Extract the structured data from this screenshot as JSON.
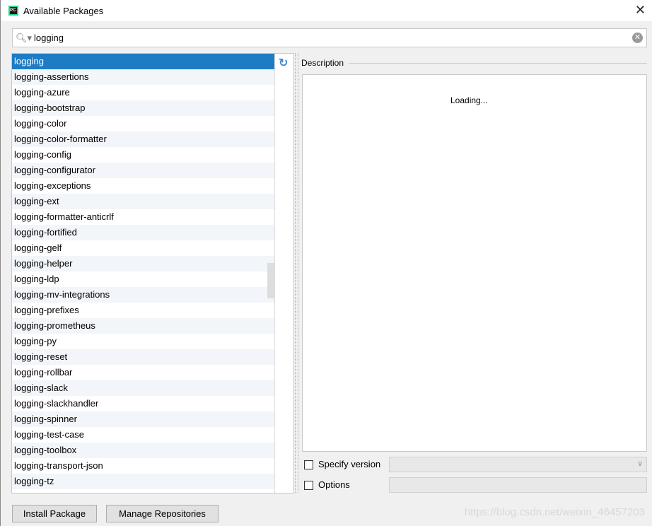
{
  "window": {
    "title": "Available Packages",
    "app_icon": "pycharm-icon",
    "close_icon": "close-icon"
  },
  "search": {
    "value": "logging",
    "icon": "search-icon",
    "clear_icon": "clear-icon"
  },
  "packages": [
    "logging",
    "logging-assertions",
    "logging-azure",
    "logging-bootstrap",
    "logging-color",
    "logging-color-formatter",
    "logging-config",
    "logging-configurator",
    "logging-exceptions",
    "logging-ext",
    "logging-formatter-anticrlf",
    "logging-fortified",
    "logging-gelf",
    "logging-helper",
    "logging-ldp",
    "logging-mv-integrations",
    "logging-prefixes",
    "logging-prometheus",
    "logging-py",
    "logging-reset",
    "logging-rollbar",
    "logging-slack",
    "logging-slackhandler",
    "logging-spinner",
    "logging-test-case",
    "logging-toolbox",
    "logging-transport-json",
    "logging-tz"
  ],
  "selected": "logging",
  "description": {
    "label": "Description",
    "content": "Loading..."
  },
  "options": {
    "specify_version": "Specify version",
    "specify_version_checked": false,
    "options": "Options",
    "options_checked": false,
    "version_value": "",
    "options_value": ""
  },
  "buttons": {
    "install": "Install Package",
    "manage": "Manage Repositories"
  },
  "watermark": "https://blog.csdn.net/weixin_46457203",
  "colors": {
    "selection": "#1e7cc4",
    "refresh": "#3d8fd8"
  }
}
